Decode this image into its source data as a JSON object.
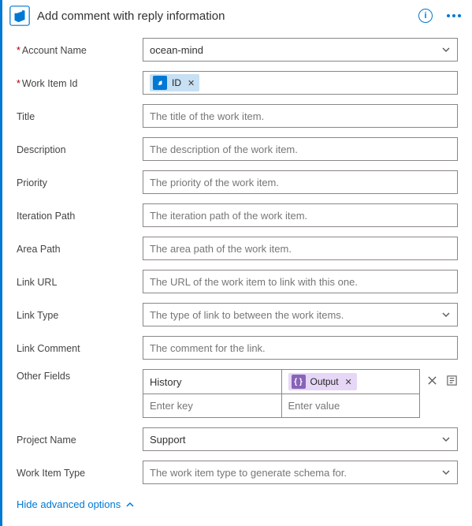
{
  "header": {
    "title": "Add comment with reply information"
  },
  "fields": {
    "accountName": {
      "label": "Account Name",
      "value": "ocean-mind"
    },
    "workItemId": {
      "label": "Work Item Id",
      "token": "ID"
    },
    "title": {
      "label": "Title",
      "placeholder": "The title of the work item."
    },
    "description": {
      "label": "Description",
      "placeholder": "The description of the work item."
    },
    "priority": {
      "label": "Priority",
      "placeholder": "The priority of the work item."
    },
    "iterationPath": {
      "label": "Iteration Path",
      "placeholder": "The iteration path of the work item."
    },
    "areaPath": {
      "label": "Area Path",
      "placeholder": "The area path of the work item."
    },
    "linkUrl": {
      "label": "Link URL",
      "placeholder": "The URL of the work item to link with this one."
    },
    "linkType": {
      "label": "Link Type",
      "placeholder": "The type of link to between the work items."
    },
    "linkComment": {
      "label": "Link Comment",
      "placeholder": "The comment for the link."
    },
    "otherFields": {
      "label": "Other Fields",
      "key1": "History",
      "valueToken": "Output",
      "keyPlaceholder": "Enter key",
      "valuePlaceholder": "Enter value"
    },
    "projectName": {
      "label": "Project Name",
      "value": "Support"
    },
    "workItemType": {
      "label": "Work Item Type",
      "placeholder": "The work item type to generate schema for."
    }
  },
  "footer": {
    "hideAdvanced": "Hide advanced options"
  }
}
